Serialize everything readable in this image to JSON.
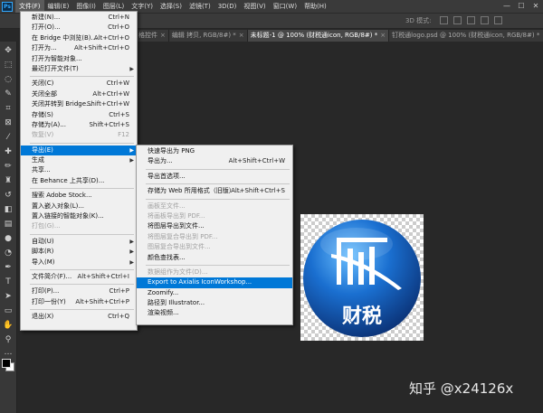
{
  "menubar": {
    "logo": "Ps",
    "items": [
      "文件(F)",
      "编辑(E)",
      "图像(I)",
      "图层(L)",
      "文字(Y)",
      "选择(S)",
      "滤镜(T)",
      "3D(D)",
      "视图(V)",
      "窗口(W)",
      "帮助(H)"
    ],
    "window_controls": [
      "—",
      "☐",
      "✕"
    ]
  },
  "options_bar": {
    "mode_label": "3D 模式:"
  },
  "tabs": [
    {
      "label": "格控件",
      "active": false
    },
    {
      "label": "编辑 拷贝, RGB/8#) *",
      "active": false
    },
    {
      "label": "未标题-1 @ 100% (财税通icon, RGB/8#) *",
      "active": true
    },
    {
      "label": "钉税通logo.psd @ 100% (财税通icon, RGB/8#) *",
      "active": false
    }
  ],
  "file_menu": {
    "rows": [
      {
        "label": "新建(N)...",
        "shortcut": "Ctrl+N"
      },
      {
        "label": "打开(O)...",
        "shortcut": "Ctrl+O"
      },
      {
        "label": "在 Bridge 中浏览(B)...",
        "shortcut": "Alt+Ctrl+O"
      },
      {
        "label": "打开为...",
        "shortcut": "Alt+Shift+Ctrl+O"
      },
      {
        "label": "打开为智能对象..."
      },
      {
        "label": "最近打开文件(T)",
        "submenu": true
      },
      {
        "sep": true
      },
      {
        "label": "关闭(C)",
        "shortcut": "Ctrl+W"
      },
      {
        "label": "关闭全部",
        "shortcut": "Alt+Ctrl+W"
      },
      {
        "label": "关闭并转到 Bridge...",
        "shortcut": "Shift+Ctrl+W"
      },
      {
        "label": "存储(S)",
        "shortcut": "Ctrl+S"
      },
      {
        "label": "存储为(A)...",
        "shortcut": "Shift+Ctrl+S"
      },
      {
        "label": "恢复(V)",
        "shortcut": "F12",
        "disabled": true
      },
      {
        "sep": true
      },
      {
        "label": "导出(E)",
        "submenu": true,
        "highlight": true
      },
      {
        "label": "生成",
        "submenu": true
      },
      {
        "label": "共享..."
      },
      {
        "label": "在 Behance 上共享(D)..."
      },
      {
        "sep": true
      },
      {
        "label": "搜索 Adobe Stock..."
      },
      {
        "label": "置入嵌入对象(L)..."
      },
      {
        "label": "置入链接的智能对象(K)..."
      },
      {
        "label": "打包(G)...",
        "disabled": true
      },
      {
        "sep": true
      },
      {
        "label": "自动(U)",
        "submenu": true
      },
      {
        "label": "脚本(R)",
        "submenu": true
      },
      {
        "label": "导入(M)",
        "submenu": true
      },
      {
        "sep": true
      },
      {
        "label": "文件简介(F)...",
        "shortcut": "Alt+Shift+Ctrl+I"
      },
      {
        "sep": true
      },
      {
        "label": "打印(P)...",
        "shortcut": "Ctrl+P"
      },
      {
        "label": "打印一份(Y)",
        "shortcut": "Alt+Shift+Ctrl+P"
      },
      {
        "sep": true
      },
      {
        "label": "退出(X)",
        "shortcut": "Ctrl+Q"
      }
    ]
  },
  "export_menu": {
    "rows": [
      {
        "label": "快速导出为 PNG"
      },
      {
        "label": "导出为...",
        "shortcut": "Alt+Shift+Ctrl+W"
      },
      {
        "sep": true
      },
      {
        "label": "导出首选项..."
      },
      {
        "sep": true
      },
      {
        "label": "存储为 Web 所用格式（旧版）...",
        "shortcut": "Alt+Shift+Ctrl+S"
      },
      {
        "sep": true
      },
      {
        "label": "画板至文件...",
        "disabled": true
      },
      {
        "label": "将画板导出到 PDF...",
        "disabled": true
      },
      {
        "label": "将图层导出到文件..."
      },
      {
        "label": "将图层复合导出到 PDF...",
        "disabled": true
      },
      {
        "label": "图层复合导出到文件...",
        "disabled": true
      },
      {
        "label": "颜色查找表..."
      },
      {
        "sep": true
      },
      {
        "label": "数据组作为文件(D)...",
        "disabled": true
      },
      {
        "label": "Export to Axialis IconWorkshop...",
        "highlight": true
      },
      {
        "label": "Zoomify..."
      },
      {
        "label": "路径到 Illustrator..."
      },
      {
        "label": "渲染视频..."
      }
    ]
  },
  "canvas": {
    "logo_text": "财税"
  },
  "watermark": "知乎 @x24126x",
  "colors": {
    "highlight": "#0078d7",
    "logo_blue": "#1a6fd0"
  }
}
